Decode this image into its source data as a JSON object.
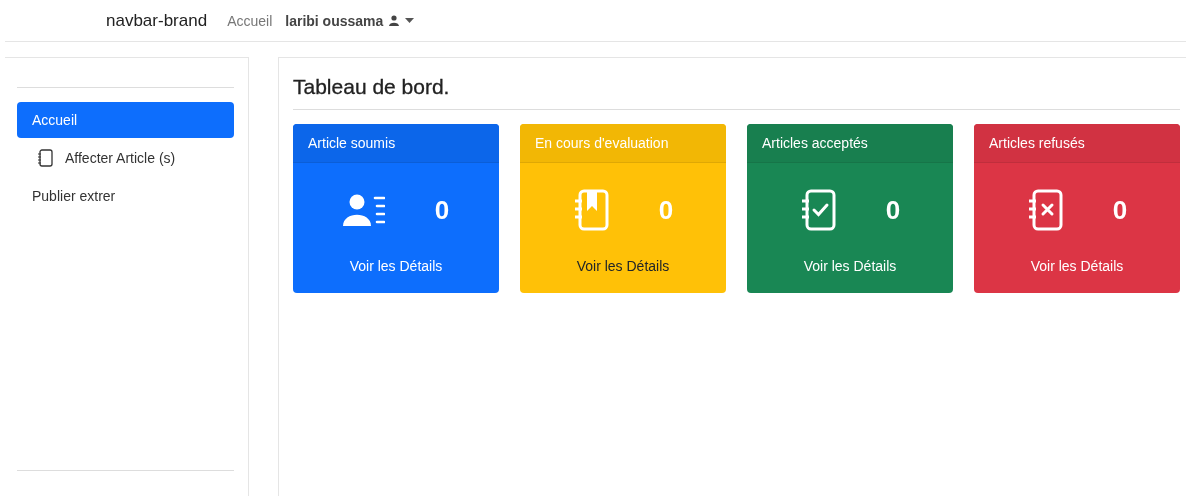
{
  "navbar": {
    "brand": "navbar-brand",
    "link": "Accueil",
    "user": "laribi oussama"
  },
  "sidebar": {
    "items": [
      {
        "label": "Accueil",
        "selected": true,
        "kind": "text"
      },
      {
        "label": "Affecter Article (s)",
        "selected": false,
        "kind": "notebook"
      },
      {
        "label": "Publier extrer",
        "selected": false,
        "kind": "text"
      }
    ]
  },
  "main": {
    "title": "Tableau de bord.",
    "cards": [
      {
        "title": "Article soumis",
        "count": "0",
        "link": "Voir les Détails",
        "kind": "primary"
      },
      {
        "title": "En cours d'evaluation",
        "count": "0",
        "link": "Voir les Détails",
        "kind": "warning"
      },
      {
        "title": "Articles acceptés",
        "count": "0",
        "link": "Voir les Détails",
        "kind": "success"
      },
      {
        "title": "Articles refusés",
        "count": "0",
        "link": "Voir les Détails",
        "kind": "danger"
      }
    ]
  }
}
